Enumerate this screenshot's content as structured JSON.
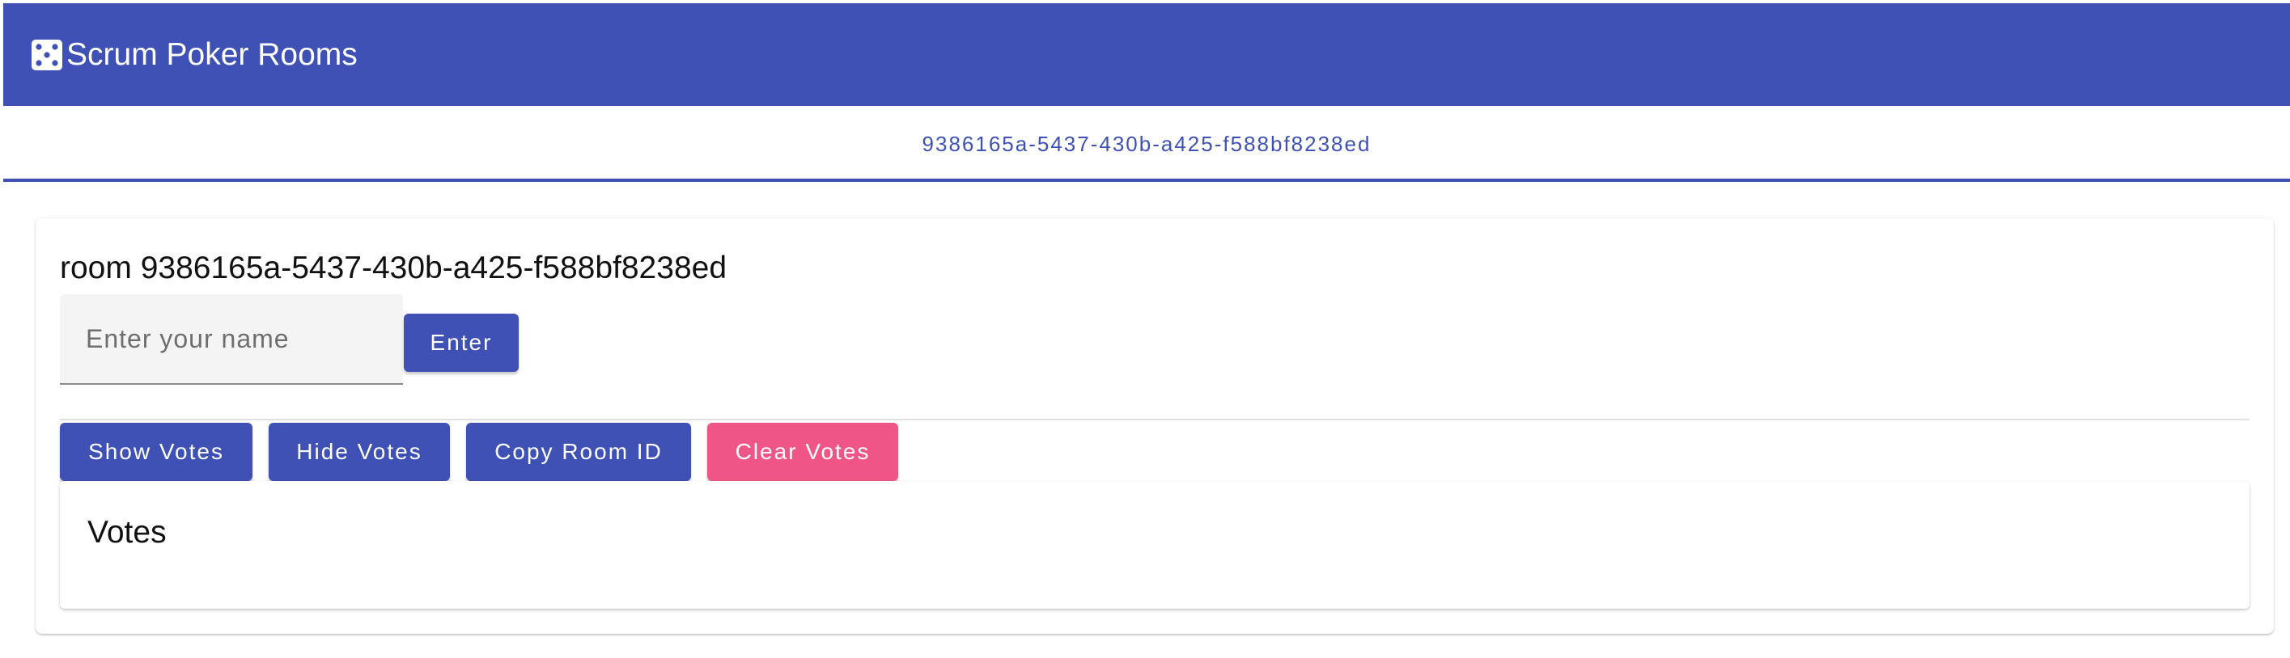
{
  "app": {
    "title": "Scrum Poker Rooms",
    "icon": "dice-icon"
  },
  "tabs": [
    {
      "label": "9386165a-5437-430b-a425-f588bf8238ed",
      "active": true
    }
  ],
  "room": {
    "title": "room 9386165a-5437-430b-a425-f588bf8238ed",
    "name_input": {
      "value": "",
      "placeholder": "Enter your name"
    },
    "enter_label": "Enter",
    "actions": {
      "show_votes": "Show Votes",
      "hide_votes": "Hide Votes",
      "copy_room_id": "Copy Room ID",
      "clear_votes": "Clear Votes"
    },
    "votes": {
      "title": "Votes"
    }
  },
  "colors": {
    "primary": "#3f51b5",
    "accent": "#ef5586"
  }
}
